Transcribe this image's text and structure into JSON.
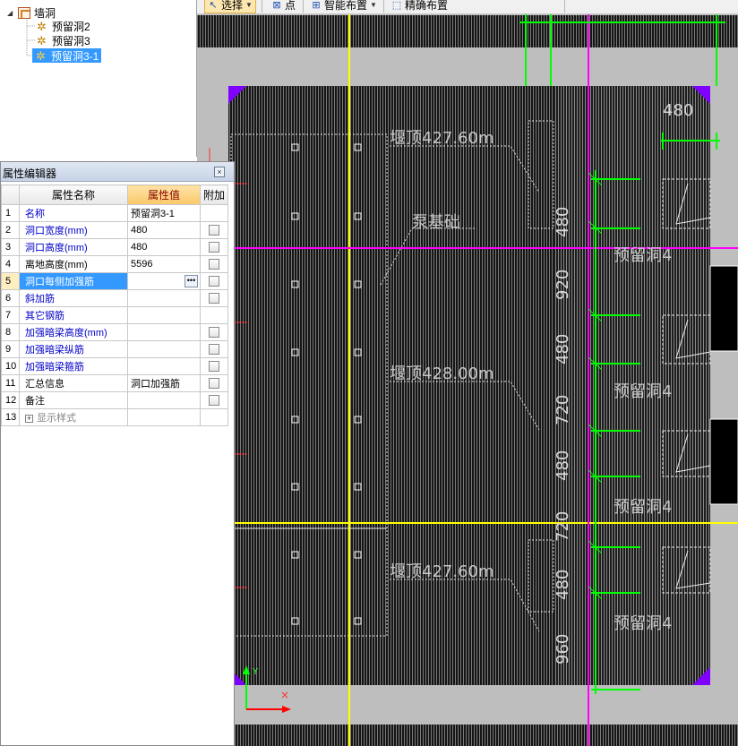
{
  "toolbar": {
    "select": "选择",
    "point": "点",
    "smart_place": "智能布置",
    "precise_place": "精确布置"
  },
  "tree": {
    "root": "墙洞",
    "children": [
      "预留洞2",
      "预留洞3",
      "预留洞3-1"
    ],
    "selected": "预留洞3-1"
  },
  "property_editor": {
    "title": "属性编辑器",
    "columns": [
      "属性名称",
      "属性值",
      "附加"
    ],
    "rows": [
      {
        "num": "1",
        "name": "名称",
        "value": "预留洞3-1",
        "has_check": false
      },
      {
        "num": "2",
        "name": "洞口宽度(mm)",
        "value": "480",
        "has_check": true
      },
      {
        "num": "3",
        "name": "洞口高度(mm)",
        "value": "480",
        "has_check": true
      },
      {
        "num": "4",
        "name": "离地高度(mm)",
        "value": "5596",
        "has_check": true
      },
      {
        "num": "5",
        "name": "洞口每侧加强筋",
        "value": "",
        "has_check": true
      },
      {
        "num": "6",
        "name": "斜加筋",
        "value": "",
        "has_check": true
      },
      {
        "num": "7",
        "name": "其它钢筋",
        "value": "",
        "has_check": false
      },
      {
        "num": "8",
        "name": "加强暗梁高度(mm)",
        "value": "",
        "has_check": true
      },
      {
        "num": "9",
        "name": "加强暗梁纵筋",
        "value": "",
        "has_check": true
      },
      {
        "num": "10",
        "name": "加强暗梁箍筋",
        "value": "",
        "has_check": true
      },
      {
        "num": "11",
        "name": "汇总信息",
        "value": "洞口加强筋",
        "has_check": true
      },
      {
        "num": "12",
        "name": "备注",
        "value": "",
        "has_check": true
      },
      {
        "num": "13",
        "name": "显示样式",
        "value": "",
        "has_check": false
      }
    ]
  },
  "cad": {
    "top_dim": "480",
    "labels": {
      "pump_base": "泵基础",
      "weir_top_1": "堰顶427.60m",
      "weir_top_2": "堰顶428.00m",
      "weir_top_3": "堰顶427.60m",
      "reserved_hole": "预留洞4"
    },
    "vertical_dims": [
      "480",
      "920",
      "480",
      "720",
      "480",
      "720",
      "480",
      "960"
    ],
    "colors": {
      "background": "#c0c0c0",
      "hatch": "#1a1a1a",
      "axis_yellow": "#ffff00",
      "axis_magenta": "#ff00ff",
      "rebar_green": "#00ff00",
      "corner_purple": "#8000ff"
    }
  }
}
